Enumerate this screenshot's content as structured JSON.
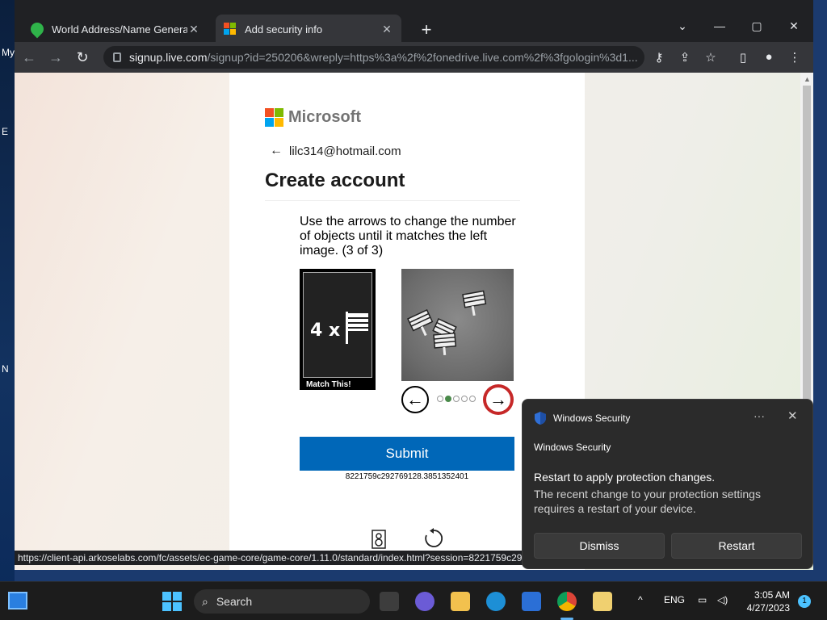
{
  "browser": {
    "tabs": [
      {
        "title": "World Address/Name Generator",
        "close": "✕"
      },
      {
        "title": "Add security info",
        "close": "✕"
      }
    ],
    "new_tab": "+",
    "window_controls": {
      "list": "⌄",
      "minimize": "—",
      "maximize": "▢",
      "close": "✕"
    },
    "url_host": "signup.live.com",
    "url_path": "/signup?id=250206&wreply=https%3a%2f%2fonedrive.live.com%2f%3fgologin%3d1...",
    "status_url": "https://client-api.arkoselabs.com/fc/assets/ec-game-core/game-core/1.11.0/standard/index.html?session=8221759c29"
  },
  "page": {
    "brand": "Microsoft",
    "back_arrow": "←",
    "email": "lilc314@hotmail.com",
    "heading": "Create account",
    "challenge": {
      "instruction": "Use the arrows to change the number of objects until it matches the left image. (3 of 3)",
      "match_label": "Match This!",
      "match_count": "4 x",
      "dots_total": 5,
      "dots_active_index": 1,
      "prev_arrow": "←",
      "next_arrow": "→"
    },
    "submit_label": "Submit",
    "session_id": "8221759c292769128.3851352401"
  },
  "toast": {
    "header": "Windows Security",
    "app_name": "Windows Security",
    "title": "Restart to apply protection changes.",
    "body": "The recent change to your protection settings requires a restart of your device.",
    "more": "···",
    "close": "✕",
    "dismiss_label": "Dismiss",
    "restart_label": "Restart"
  },
  "taskbar": {
    "search_label": "Search",
    "language": "ENG",
    "time": "3:05 AM",
    "date": "4/27/2023",
    "notification_count": "1"
  },
  "desktop": {
    "fragments": [
      "My",
      "E",
      "N"
    ]
  },
  "colors": {
    "submit_blue": "#0067b8",
    "chrome_dark": "#202124",
    "toast_bg": "#2b2b2b"
  }
}
